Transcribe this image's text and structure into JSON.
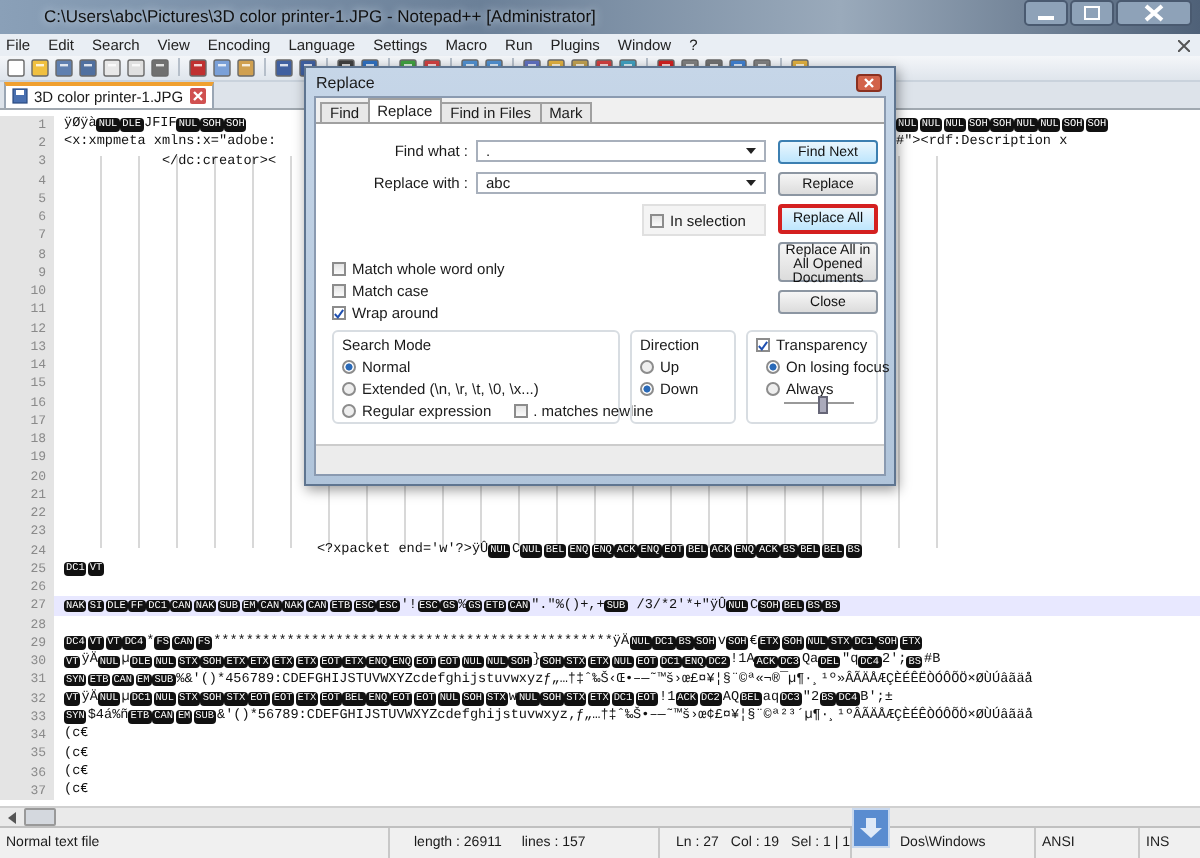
{
  "window": {
    "title": "C:\\Users\\abc\\Pictures\\3D color printer-1.JPG - Notepad++ [Administrator]"
  },
  "menu": [
    "File",
    "Edit",
    "Search",
    "View",
    "Encoding",
    "Language",
    "Settings",
    "Macro",
    "Run",
    "Plugins",
    "Window",
    "?"
  ],
  "document_tabs": [
    {
      "label": "3D color printer-1.JPG",
      "selected": true
    }
  ],
  "editor": {
    "lines": [
      {
        "number": "1",
        "current": false,
        "left": [
          {
            "kind": "text",
            "text": "ÿØÿà"
          },
          {
            "kind": "control",
            "text": "NUL"
          },
          {
            "kind": "control",
            "text": "DLE"
          },
          {
            "kind": "text",
            "text": "JFIF"
          },
          {
            "kind": "control",
            "text": "NUL"
          },
          {
            "kind": "control",
            "text": "SOH"
          },
          {
            "kind": "control",
            "text": "SOH"
          }
        ],
        "right": [
          {
            "kind": "control",
            "text": "NUL"
          },
          {
            "kind": "control",
            "text": "NUL"
          },
          {
            "kind": "control",
            "text": "NUL"
          },
          {
            "kind": "control",
            "text": "SOH"
          },
          {
            "kind": "control",
            "text": "SOH"
          },
          {
            "kind": "control",
            "text": "NUL"
          },
          {
            "kind": "control",
            "text": "NUL"
          },
          {
            "kind": "control",
            "text": "SOH"
          },
          {
            "kind": "control",
            "text": "SOH"
          }
        ]
      },
      {
        "number": "2",
        "current": false,
        "left": [
          {
            "kind": "text",
            "text": "<x:xmpmeta xmlns:x=\"adobe:"
          }
        ],
        "right": [
          {
            "kind": "text",
            "text": "#\"><rdf:Description x"
          }
        ]
      },
      {
        "number": "3",
        "current": false,
        "left": [
          {
            "kind": "text",
            "text": "            </dc:creator><"
          }
        ]
      },
      {
        "number": "4",
        "current": false
      },
      {
        "number": "5",
        "current": false
      },
      {
        "number": "6",
        "current": false
      },
      {
        "number": "7",
        "current": false
      },
      {
        "number": "8",
        "current": false
      },
      {
        "number": "9",
        "current": false
      },
      {
        "number": "10",
        "current": false
      },
      {
        "number": "11",
        "current": false
      },
      {
        "number": "12",
        "current": false
      },
      {
        "number": "13",
        "current": false
      },
      {
        "number": "14",
        "current": false
      },
      {
        "number": "15",
        "current": false
      },
      {
        "number": "16",
        "current": false
      },
      {
        "number": "17",
        "current": false
      },
      {
        "number": "18",
        "current": false
      },
      {
        "number": "19",
        "current": false
      },
      {
        "number": "20",
        "current": false
      },
      {
        "number": "21",
        "current": false
      },
      {
        "number": "22",
        "current": false
      },
      {
        "number": "23",
        "current": false
      },
      {
        "number": "24",
        "current": false,
        "left": [
          {
            "kind": "text",
            "text": "                               <?xpacket end='w'?>ÿÛ"
          },
          {
            "kind": "control",
            "text": "NUL"
          },
          {
            "kind": "text",
            "text": "C"
          },
          {
            "kind": "control",
            "text": "NUL"
          },
          {
            "kind": "control",
            "text": "BEL"
          },
          {
            "kind": "control",
            "text": "ENQ"
          },
          {
            "kind": "control",
            "text": "ENQ"
          },
          {
            "kind": "control",
            "text": "ACK"
          },
          {
            "kind": "control",
            "text": "ENQ"
          },
          {
            "kind": "control",
            "text": "EOT"
          },
          {
            "kind": "control",
            "text": "BEL"
          },
          {
            "kind": "control",
            "text": "ACK"
          },
          {
            "kind": "control",
            "text": "ENQ"
          },
          {
            "kind": "control",
            "text": "ACK"
          },
          {
            "kind": "control",
            "text": "BS"
          },
          {
            "kind": "control",
            "text": "BEL"
          },
          {
            "kind": "control",
            "text": "BEL"
          },
          {
            "kind": "control",
            "text": "BS"
          }
        ]
      },
      {
        "number": "25",
        "current": false,
        "left": [
          {
            "kind": "control",
            "text": "DC1"
          },
          {
            "kind": "control",
            "text": "VT"
          }
        ]
      },
      {
        "number": "26",
        "current": false
      },
      {
        "number": "27",
        "current": true,
        "left": [
          {
            "kind": "control",
            "text": "NAK"
          },
          {
            "kind": "control",
            "text": "SI"
          },
          {
            "kind": "control",
            "text": "DLE"
          },
          {
            "kind": "control",
            "text": "FF"
          },
          {
            "kind": "control",
            "text": "DC1"
          },
          {
            "kind": "control",
            "text": "CAN"
          },
          {
            "kind": "control",
            "text": "NAK"
          },
          {
            "kind": "control",
            "text": "SUB"
          },
          {
            "kind": "control",
            "text": "EM"
          },
          {
            "kind": "control",
            "text": "CAN"
          },
          {
            "kind": "control",
            "text": "NAK"
          },
          {
            "kind": "control",
            "text": "CAN"
          },
          {
            "kind": "control",
            "text": "ETB"
          },
          {
            "kind": "control",
            "text": "ESC"
          },
          {
            "kind": "control",
            "text": "ESC"
          },
          {
            "kind": "text",
            "text": "'!"
          },
          {
            "kind": "control",
            "text": "ESC"
          },
          {
            "kind": "control",
            "text": "GS"
          },
          {
            "kind": "text",
            "text": "%"
          },
          {
            "kind": "control",
            "text": "GS"
          },
          {
            "kind": "control",
            "text": "ETB"
          },
          {
            "kind": "control",
            "text": "CAN"
          },
          {
            "kind": "text",
            "text": "\".\"%()+,+"
          },
          {
            "kind": "control",
            "text": "SUB"
          },
          {
            "kind": "text",
            "text": " /3/*2'*+\"ÿÛ"
          },
          {
            "kind": "control",
            "text": "NUL"
          },
          {
            "kind": "text",
            "text": "C"
          },
          {
            "kind": "control",
            "text": "SOH"
          },
          {
            "kind": "control",
            "text": "BEL"
          },
          {
            "kind": "control",
            "text": "BS"
          },
          {
            "kind": "control",
            "text": "BS"
          }
        ]
      },
      {
        "number": "28",
        "current": false
      },
      {
        "number": "29",
        "current": false,
        "left": [
          {
            "kind": "control",
            "text": "DC4"
          },
          {
            "kind": "control",
            "text": "VT"
          },
          {
            "kind": "control",
            "text": "VT"
          },
          {
            "kind": "control",
            "text": "DC4"
          },
          {
            "kind": "text",
            "text": "*"
          },
          {
            "kind": "control",
            "text": "FS"
          },
          {
            "kind": "control",
            "text": "CAN"
          },
          {
            "kind": "control",
            "text": "FS"
          },
          {
            "kind": "text",
            "text": "*************************************************ÿÄ"
          },
          {
            "kind": "control",
            "text": "NUL"
          },
          {
            "kind": "control",
            "text": "DC1"
          },
          {
            "kind": "control",
            "text": "BS"
          },
          {
            "kind": "control",
            "text": "SOH"
          },
          {
            "kind": "text",
            "text": "v"
          },
          {
            "kind": "control",
            "text": "SOH"
          },
          {
            "kind": "text",
            "text": "€"
          },
          {
            "kind": "control",
            "text": "ETX"
          },
          {
            "kind": "control",
            "text": "SOH"
          },
          {
            "kind": "control",
            "text": "NUL"
          },
          {
            "kind": "control",
            "text": "STX"
          },
          {
            "kind": "control",
            "text": "DC1"
          },
          {
            "kind": "control",
            "text": "SOH"
          },
          {
            "kind": "control",
            "text": "ETX"
          }
        ]
      },
      {
        "number": "30",
        "current": false,
        "left": [
          {
            "kind": "control",
            "text": "VT"
          },
          {
            "kind": "text",
            "text": "ÿÄ"
          },
          {
            "kind": "control",
            "text": "NUL"
          },
          {
            "kind": "text",
            "text": "µ"
          },
          {
            "kind": "control",
            "text": "DLE"
          },
          {
            "kind": "control",
            "text": "NUL"
          },
          {
            "kind": "control",
            "text": "STX"
          },
          {
            "kind": "control",
            "text": "SOH"
          },
          {
            "kind": "control",
            "text": "ETX"
          },
          {
            "kind": "control",
            "text": "ETX"
          },
          {
            "kind": "control",
            "text": "ETX"
          },
          {
            "kind": "control",
            "text": "ETX"
          },
          {
            "kind": "control",
            "text": "EOT"
          },
          {
            "kind": "control",
            "text": "ETX"
          },
          {
            "kind": "control",
            "text": "ENQ"
          },
          {
            "kind": "control",
            "text": "ENQ"
          },
          {
            "kind": "control",
            "text": "EOT"
          },
          {
            "kind": "control",
            "text": "EOT"
          },
          {
            "kind": "control",
            "text": "NUL"
          },
          {
            "kind": "control",
            "text": "NUL"
          },
          {
            "kind": "control",
            "text": "SOH"
          },
          {
            "kind": "text",
            "text": "}"
          },
          {
            "kind": "control",
            "text": "SOH"
          },
          {
            "kind": "control",
            "text": "STX"
          },
          {
            "kind": "control",
            "text": "ETX"
          },
          {
            "kind": "control",
            "text": "NUL"
          },
          {
            "kind": "control",
            "text": "EOT"
          },
          {
            "kind": "control",
            "text": "DC1"
          },
          {
            "kind": "control",
            "text": "ENQ"
          },
          {
            "kind": "control",
            "text": "DC2"
          },
          {
            "kind": "text",
            "text": "!1A"
          },
          {
            "kind": "control",
            "text": "ACK"
          },
          {
            "kind": "control",
            "text": "DC3"
          },
          {
            "kind": "text",
            "text": "Qa"
          },
          {
            "kind": "control",
            "text": "DEL"
          },
          {
            "kind": "text",
            "text": "\"q"
          },
          {
            "kind": "control",
            "text": "DC4"
          },
          {
            "kind": "text",
            "text": "2';"
          },
          {
            "kind": "control",
            "text": "BS"
          },
          {
            "kind": "text",
            "text": "#B"
          }
        ]
      },
      {
        "number": "31",
        "current": false,
        "left": [
          {
            "kind": "control",
            "text": "SYN"
          },
          {
            "kind": "control",
            "text": "ETB"
          },
          {
            "kind": "control",
            "text": "CAN"
          },
          {
            "kind": "control",
            "text": "EM"
          },
          {
            "kind": "control",
            "text": "SUB"
          },
          {
            "kind": "text",
            "text": "%&'()*456789:CDEFGHIJSTUVWXYZcdefghijstuvwxyzƒ„…†‡ˆ‰Š‹Œ•–—˜™š›œ£¤¥¦§¨©ª«¬®¯µ¶·¸¹º»ÂÃÄÅÆÇÈÉÊËÒÓÔÕÖ×ØÙÚâãäå"
          }
        ]
      },
      {
        "number": "32",
        "current": false,
        "left": [
          {
            "kind": "control",
            "text": "VT"
          },
          {
            "kind": "text",
            "text": "ÿÄ"
          },
          {
            "kind": "control",
            "text": "NUL"
          },
          {
            "kind": "text",
            "text": "µ"
          },
          {
            "kind": "control",
            "text": "DC1"
          },
          {
            "kind": "control",
            "text": "NUL"
          },
          {
            "kind": "control",
            "text": "STX"
          },
          {
            "kind": "control",
            "text": "SOH"
          },
          {
            "kind": "control",
            "text": "STX"
          },
          {
            "kind": "control",
            "text": "EOT"
          },
          {
            "kind": "control",
            "text": "EOT"
          },
          {
            "kind": "control",
            "text": "ETX"
          },
          {
            "kind": "control",
            "text": "EOT"
          },
          {
            "kind": "control",
            "text": "BEL"
          },
          {
            "kind": "control",
            "text": "ENQ"
          },
          {
            "kind": "control",
            "text": "EOT"
          },
          {
            "kind": "control",
            "text": "EOT"
          },
          {
            "kind": "control",
            "text": "NUL"
          },
          {
            "kind": "control",
            "text": "SOH"
          },
          {
            "kind": "control",
            "text": "STX"
          },
          {
            "kind": "text",
            "text": "w"
          },
          {
            "kind": "control",
            "text": "NUL"
          },
          {
            "kind": "control",
            "text": "SOH"
          },
          {
            "kind": "control",
            "text": "STX"
          },
          {
            "kind": "control",
            "text": "ETX"
          },
          {
            "kind": "control",
            "text": "DC1"
          },
          {
            "kind": "control",
            "text": "EOT"
          },
          {
            "kind": "text",
            "text": "!1"
          },
          {
            "kind": "control",
            "text": "ACK"
          },
          {
            "kind": "control",
            "text": "DC2"
          },
          {
            "kind": "text",
            "text": "AQ"
          },
          {
            "kind": "control",
            "text": "BEL"
          },
          {
            "kind": "text",
            "text": "aq"
          },
          {
            "kind": "control",
            "text": "DC3"
          },
          {
            "kind": "text",
            "text": "\"2"
          },
          {
            "kind": "control",
            "text": "BS"
          },
          {
            "kind": "control",
            "text": "DC4"
          },
          {
            "kind": "text",
            "text": "B';±"
          }
        ]
      },
      {
        "number": "33",
        "current": false,
        "left": [
          {
            "kind": "control",
            "text": "SYN"
          },
          {
            "kind": "text",
            "text": "$4á%ñ"
          },
          {
            "kind": "control",
            "text": "ETB"
          },
          {
            "kind": "control",
            "text": "CAN"
          },
          {
            "kind": "control",
            "text": "EM"
          },
          {
            "kind": "control",
            "text": "SUB"
          },
          {
            "kind": "text",
            "text": "&'()*56789:CDEFGHIJSTUVWXYZcdefghijstuvwxyz‚ƒ„…†‡ˆ‰Š•–—˜™š›œ¢£¤¥¦§¨©ª²³´µ¶·¸¹ºÂÃÄÅÆÇÈÉÊÒÓÔÕÖ×ØÙÚâãäå"
          }
        ]
      },
      {
        "number": "34",
        "current": false,
        "left": [
          {
            "kind": "text",
            "text": "(c€"
          }
        ]
      },
      {
        "number": "35",
        "current": false,
        "left": [
          {
            "kind": "text",
            "text": "(c€"
          }
        ]
      },
      {
        "number": "36",
        "current": false,
        "left": [
          {
            "kind": "text",
            "text": "(c€"
          }
        ]
      },
      {
        "number": "37",
        "current": false,
        "left": [
          {
            "kind": "text",
            "text": "(c€"
          }
        ]
      }
    ]
  },
  "status_bar": {
    "file_type": "Normal text file",
    "length": "length : 26911",
    "lines": "lines : 157",
    "ln": "Ln : 27",
    "col": "Col : 19",
    "sel": "Sel : 1 | 1",
    "eol": "Dos\\Windows",
    "encoding": "ANSI",
    "mode": "INS"
  },
  "dialog": {
    "title": "Replace",
    "tabs": [
      {
        "label": "Find",
        "selected": false
      },
      {
        "label": "Replace",
        "selected": true
      },
      {
        "label": "Find in Files",
        "selected": false
      },
      {
        "label": "Mark",
        "selected": false
      }
    ],
    "find_what": {
      "label": "Find what :",
      "value": "."
    },
    "replace_with": {
      "label": "Replace with :",
      "value": "abc"
    },
    "in_selection": {
      "label": "In selection",
      "checked": false
    },
    "buttons": [
      {
        "label": "Find Next",
        "highlighted": false
      },
      {
        "label": "Replace",
        "highlighted": false
      },
      {
        "label": "Replace All",
        "highlighted": true
      },
      {
        "label": "Replace All in All Opened Documents",
        "highlighted": false
      },
      {
        "label": "Close",
        "highlighted": false
      }
    ],
    "options": [
      {
        "label": "Match whole word only",
        "checked": false
      },
      {
        "label": "Match case",
        "checked": false
      },
      {
        "label": "Wrap around",
        "checked": true
      }
    ],
    "search_mode": {
      "title": "Search Mode",
      "options": [
        {
          "label": "Normal",
          "selected": true
        },
        {
          "label": "Extended (\\n, \\r, \\t, \\0, \\x...)",
          "selected": false
        },
        {
          "label": "Regular expression",
          "selected": false
        }
      ],
      "matches_newline": {
        "label": ". matches newline",
        "checked": false
      }
    },
    "direction": {
      "title": "Direction",
      "options": [
        {
          "label": "Up",
          "selected": false
        },
        {
          "label": "Down",
          "selected": true
        }
      ]
    },
    "transparency": {
      "label": "Transparency",
      "checked": true,
      "options": [
        {
          "label": "On losing focus",
          "selected": true
        },
        {
          "label": "Always",
          "selected": false
        }
      ],
      "level": 0.55
    }
  }
}
